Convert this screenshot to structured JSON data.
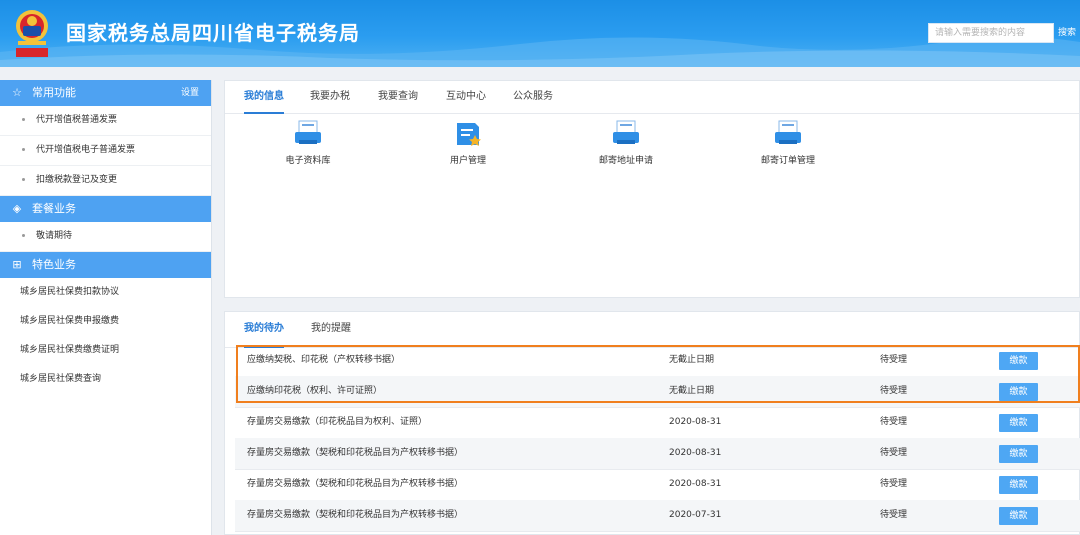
{
  "header": {
    "title": "国家税务总局四川省电子税务局",
    "search_placeholder": "请输入需要搜索的内容",
    "search_button": "搜索",
    "emblem_icon": "tax-emblem-icon"
  },
  "sidebar": {
    "common": {
      "title": "常用功能",
      "settings": "设置",
      "icon": "star-icon",
      "items": [
        "代开增值税普通发票",
        "代开增值税电子普通发票",
        "扣缴税款登记及变更"
      ]
    },
    "package": {
      "title": "套餐业务",
      "icon": "layers-icon",
      "items": [
        "敬请期待"
      ]
    },
    "special": {
      "title": "特色业务",
      "icon": "grid-icon",
      "items": [
        "城乡居民社保费扣款协议",
        "城乡居民社保费申报缴费",
        "城乡居民社保费缴费证明",
        "城乡居民社保费查询"
      ]
    }
  },
  "info_panel": {
    "tabs": [
      "我的信息",
      "我要办税",
      "我要查询",
      "互动中心",
      "公众服务"
    ],
    "active_tab": "我的信息",
    "apps": [
      {
        "label": "电子资料库",
        "icon": "printer-icon"
      },
      {
        "label": "用户管理",
        "icon": "user-manage-icon"
      },
      {
        "label": "邮寄地址申请",
        "icon": "printer-icon"
      },
      {
        "label": "邮寄订单管理",
        "icon": "printer-icon"
      }
    ]
  },
  "todo_panel": {
    "tabs": [
      "我的待办",
      "我的提醒"
    ],
    "active_tab": "我的待办",
    "pay_label": "缴款",
    "rows": [
      {
        "name": "应缴纳契税、印花税（产权转移书据）",
        "deadline": "无截止日期",
        "status": "待受理"
      },
      {
        "name": "应缴纳印花税（权利、许可证照）",
        "deadline": "无截止日期",
        "status": "待受理"
      },
      {
        "name": "存量房交易缴款（印花税品目为权利、证照）",
        "deadline": "2020-08-31",
        "status": "待受理"
      },
      {
        "name": "存量房交易缴款（契税和印花税品目为产权转移书据）",
        "deadline": "2020-08-31",
        "status": "待受理"
      },
      {
        "name": "存量房交易缴款（契税和印花税品目为产权转移书据）",
        "deadline": "2020-08-31",
        "status": "待受理"
      },
      {
        "name": "存量房交易缴款（契税和印花税品目为产权转移书据）",
        "deadline": "2020-07-31",
        "status": "待受理"
      }
    ]
  },
  "colors": {
    "header_blue": "#2b9df0",
    "sidebar_head": "#4ea2f2",
    "active_tab": "#2a7dd6",
    "pay_button": "#4ea7f4",
    "highlight_border": "#f07f1e"
  }
}
